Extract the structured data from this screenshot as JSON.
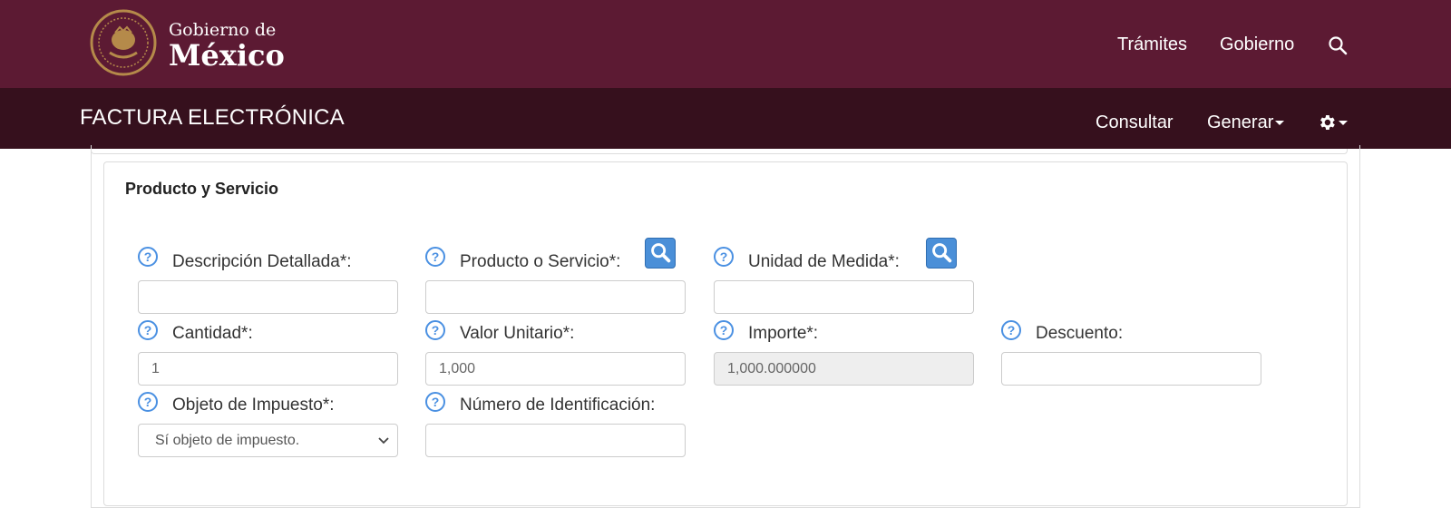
{
  "header": {
    "brand_small": "Gobierno de",
    "brand_big": "México",
    "nav": [
      "Trámites",
      "Gobierno"
    ]
  },
  "subheader": {
    "title": "FACTURA ELECTRÓNICA",
    "nav": {
      "consultar": "Consultar",
      "generar": "Generar"
    }
  },
  "icons": {
    "search": "search-icon",
    "gear": "gear-icon",
    "help": "help-circle-icon",
    "seal": "seal-icon"
  },
  "colors": {
    "topbar": "#5c1a33",
    "subbar": "#36101d",
    "help": "#4a90e2",
    "search_button": "#4a8fd8"
  },
  "form": {
    "section_title": "Producto y Servicio",
    "help_symbol": "?",
    "fields": {
      "descripcion": {
        "label": "Descripción Detallada*:",
        "value": ""
      },
      "producto": {
        "label": "Producto o Servicio*:",
        "value": ""
      },
      "unidad": {
        "label": "Unidad de Medida*:",
        "value": ""
      },
      "cantidad": {
        "label": "Cantidad*:",
        "value": "1"
      },
      "valor_unitario": {
        "label": "Valor Unitario*:",
        "value": "1,000"
      },
      "importe": {
        "label": "Importe*:",
        "value": "1,000.000000"
      },
      "descuento": {
        "label": "Descuento:",
        "value": ""
      },
      "objeto_impuesto": {
        "label": "Objeto de Impuesto*:",
        "selected": "Sí objeto de impuesto."
      },
      "numero_identificacion": {
        "label": "Número de Identificación:",
        "value": ""
      }
    }
  }
}
